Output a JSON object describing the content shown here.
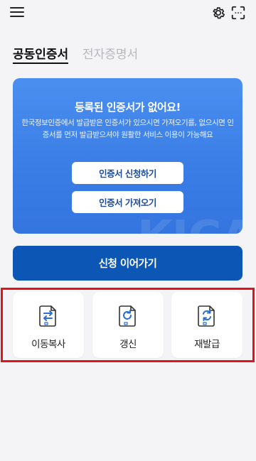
{
  "header": {
    "menu_icon": "hamburger-menu-icon",
    "settings_icon": "gear-icon",
    "scan_icon": "scan-frame-icon"
  },
  "tabs": [
    {
      "label": "공동인증서",
      "active": true
    },
    {
      "label": "전자증명서",
      "active": false
    }
  ],
  "empty_card": {
    "title": "등록된 인증서가 없어요!",
    "description": "한국정보인증에서 발급받은 인증서가 있으시면 가져오기를, 없으시면 인증서를 먼저 발급받으셔야 원활한 서비스 이용이 가능해요",
    "watermark": "KICA",
    "apply_label": "인증서 신청하기",
    "import_label": "인증서 가져오기"
  },
  "continue_label": "신청 이어가기",
  "actions": [
    {
      "label": "이동복사",
      "icon": "transfer-arrows-document-icon"
    },
    {
      "label": "갱신",
      "icon": "renew-document-icon"
    },
    {
      "label": "재발급",
      "icon": "reissue-document-icon"
    }
  ],
  "colors": {
    "card_blue": "#3b7ee6",
    "primary_button": "#0c57b5",
    "icon_blue": "#2a6fd1",
    "highlight": "#e0141a",
    "background": "#f4f4f6"
  }
}
